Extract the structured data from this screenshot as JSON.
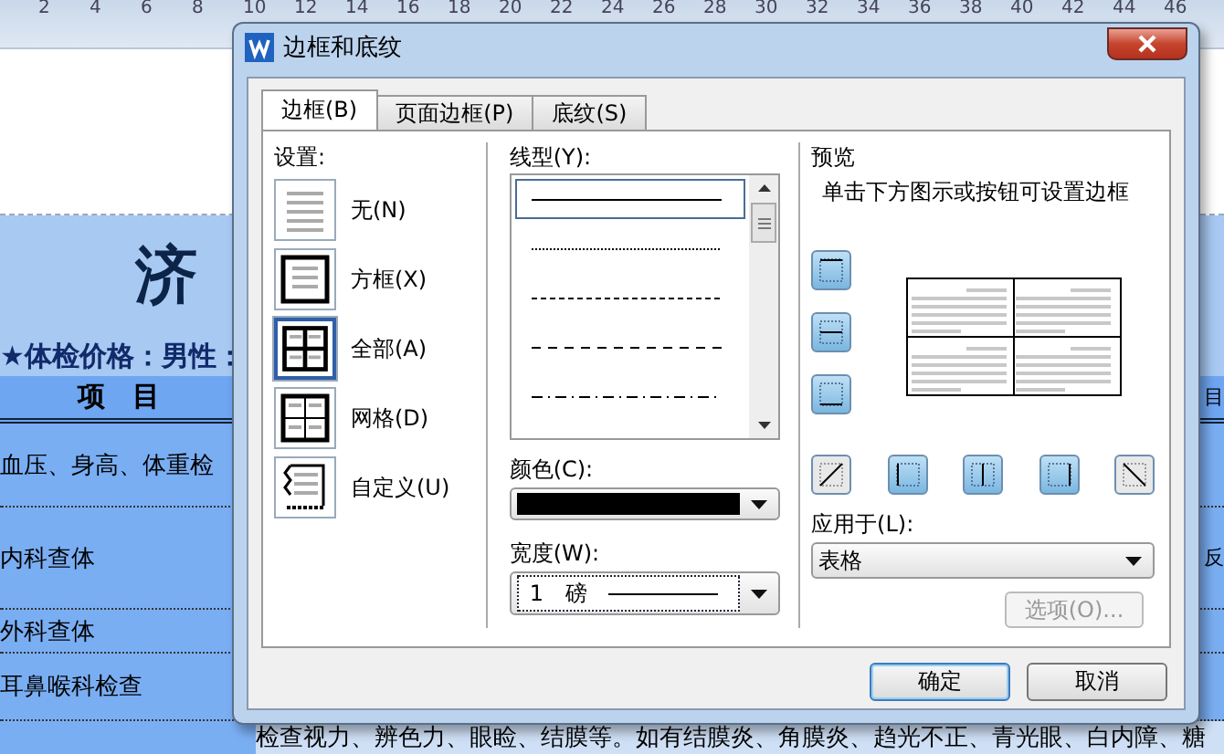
{
  "document": {
    "ruler_numbers": [
      "2",
      "4",
      "6",
      "8",
      "10",
      "12",
      "14",
      "16",
      "18",
      "20",
      "22",
      "24",
      "26",
      "28",
      "30",
      "32",
      "34",
      "36",
      "38",
      "40",
      "42",
      "44",
      "46"
    ],
    "title": "济",
    "price_line": "★体检价格：男性：",
    "header": "项　目",
    "header_right": "目",
    "rows": [
      {
        "item": "血压、身高、体重检"
      },
      {
        "item": "内科查体",
        "note": "反"
      },
      {
        "item": "外科查体"
      },
      {
        "item": "耳鼻喉科检查"
      }
    ],
    "bottom_text": "检查视力、辨色力、眼睑、结膜等。如有结膜炎、角膜炎、趋光不正、青光眼、白内障、糖"
  },
  "dialog": {
    "title": "边框和底纹",
    "tabs": [
      {
        "label": "边框(B)",
        "selected": true
      },
      {
        "label": "页面边框(P)",
        "selected": false
      },
      {
        "label": "底纹(S)",
        "selected": false
      }
    ],
    "settings": {
      "label": "设置:",
      "options": [
        {
          "label": "无(N)",
          "kind": "none",
          "selected": false
        },
        {
          "label": "方框(X)",
          "kind": "box",
          "selected": false
        },
        {
          "label": "全部(A)",
          "kind": "all",
          "selected": true
        },
        {
          "label": "网格(D)",
          "kind": "grid",
          "selected": false
        },
        {
          "label": "自定义(U)",
          "kind": "custom",
          "selected": false
        }
      ]
    },
    "line_style": {
      "label": "线型(Y):",
      "styles": [
        {
          "kind": "solid",
          "selected": true
        },
        {
          "kind": "dotted",
          "selected": false
        },
        {
          "kind": "dashed",
          "selected": false
        },
        {
          "kind": "long-dash",
          "selected": false
        },
        {
          "kind": "dash-dot",
          "selected": false
        }
      ]
    },
    "color": {
      "label": "颜色(C):"
    },
    "width": {
      "label": "宽度(W):",
      "value": "1",
      "unit": "磅"
    },
    "preview": {
      "label": "预览",
      "hint": "单击下方图示或按钮可设置边框",
      "side_buttons": [
        {
          "kind": "top",
          "on": true
        },
        {
          "kind": "inner-horizontal",
          "on": true
        },
        {
          "kind": "bottom",
          "on": true
        }
      ],
      "bottom_buttons": [
        {
          "kind": "diagonal-up",
          "on": false
        },
        {
          "kind": "left",
          "on": true
        },
        {
          "kind": "inner-vertical",
          "on": true
        },
        {
          "kind": "right",
          "on": true
        },
        {
          "kind": "diagonal-down",
          "on": false
        }
      ]
    },
    "apply_to": {
      "label": "应用于(L):",
      "value": "表格"
    },
    "options_button": {
      "label": "选项(O)...",
      "disabled": true
    },
    "buttons": [
      {
        "label": "确定",
        "default": true
      },
      {
        "label": "取消",
        "default": false
      }
    ]
  }
}
